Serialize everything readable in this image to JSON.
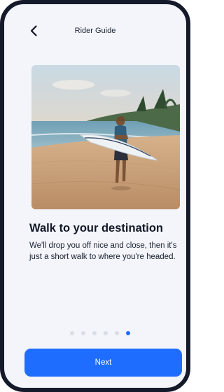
{
  "header": {
    "title": "Rider Guide"
  },
  "onboarding": {
    "heading": "Walk to your destination",
    "body": "We'll drop you off nice and close, then it's just a short walk to where you're headed."
  },
  "pagination": {
    "total": 6,
    "current": 6
  },
  "actions": {
    "next_label": "Next"
  },
  "icons": {
    "back": "chevron-left-icon"
  },
  "colors": {
    "accent": "#1f6dff",
    "background": "#f3f5fa",
    "frame": "#151a2b"
  }
}
